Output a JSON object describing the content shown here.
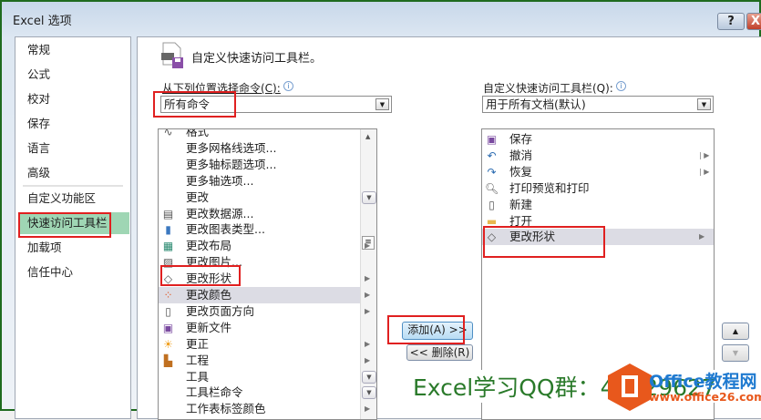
{
  "window": {
    "title": "Excel 选项",
    "help_label": "?",
    "close_label": "X"
  },
  "nav": {
    "items": [
      {
        "label": "常规"
      },
      {
        "label": "公式"
      },
      {
        "label": "校对"
      },
      {
        "label": "保存"
      },
      {
        "label": "语言"
      },
      {
        "label": "高级"
      },
      {
        "label": "自定义功能区"
      },
      {
        "label": "快速访问工具栏",
        "selected": true
      },
      {
        "label": "加载项"
      },
      {
        "label": "信任中心"
      }
    ]
  },
  "header": {
    "title": "自定义快速访问工具栏。"
  },
  "commands": {
    "label": "从下列位置选择命令(C):",
    "selected": "所有命令",
    "items": [
      {
        "label": "格式",
        "icon": "chart-line-icon"
      },
      {
        "label": "更多网格线选项..."
      },
      {
        "label": "更多轴标题选项..."
      },
      {
        "label": "更多轴选项..."
      },
      {
        "label": "更改",
        "dropdown": true
      },
      {
        "label": "更改数据源...",
        "icon": "data-source-icon"
      },
      {
        "label": "更改图表类型...",
        "icon": "bar-chart-icon"
      },
      {
        "label": "更改布局",
        "icon": "layout-icon",
        "submenu": true
      },
      {
        "label": "更改图片...",
        "icon": "picture-icon"
      },
      {
        "label": "更改形状",
        "icon": "shape-icon",
        "submenu": true
      },
      {
        "label": "更改颜色",
        "icon": "colors-icon",
        "submenu": true,
        "highlighted": true
      },
      {
        "label": "更改页面方向",
        "icon": "orientation-icon",
        "submenu": true
      },
      {
        "label": "更新文件",
        "icon": "update-file-icon"
      },
      {
        "label": "更正",
        "icon": "sun-icon",
        "submenu": true
      },
      {
        "label": "工程",
        "icon": "project-icon",
        "submenu": true
      },
      {
        "label": "工具",
        "dropdown": true
      },
      {
        "label": "工具栏命令",
        "dropdown": true
      },
      {
        "label": "工作表标签颜色",
        "submenu": true
      }
    ]
  },
  "toolbar": {
    "label": "自定义快速访问工具栏(Q):",
    "selected": "用于所有文档(默认)",
    "items": [
      {
        "label": "保存",
        "icon": "save-icon"
      },
      {
        "label": "撤消",
        "icon": "undo-icon",
        "split": true
      },
      {
        "label": "恢复",
        "icon": "redo-icon",
        "split": true
      },
      {
        "label": "打印预览和打印",
        "icon": "print-preview-icon"
      },
      {
        "label": "新建",
        "icon": "new-file-icon"
      },
      {
        "label": "打开",
        "icon": "folder-icon"
      },
      {
        "label": "更改形状",
        "icon": "shape-icon",
        "submenu": true,
        "highlighted": true
      }
    ]
  },
  "buttons": {
    "add": "添加(A) >>",
    "remove": "<< 删除(R)"
  },
  "watermark": {
    "text": "Excel学习QQ群：48829627",
    "logo_title": "Office教程网",
    "logo_url": "www.office26.com"
  },
  "colors": {
    "highlight_red": "#e02020",
    "nav_selected": "#9fd6b4",
    "watermark_green": "#2a7a2a",
    "logo_orange": "#e8581c"
  }
}
